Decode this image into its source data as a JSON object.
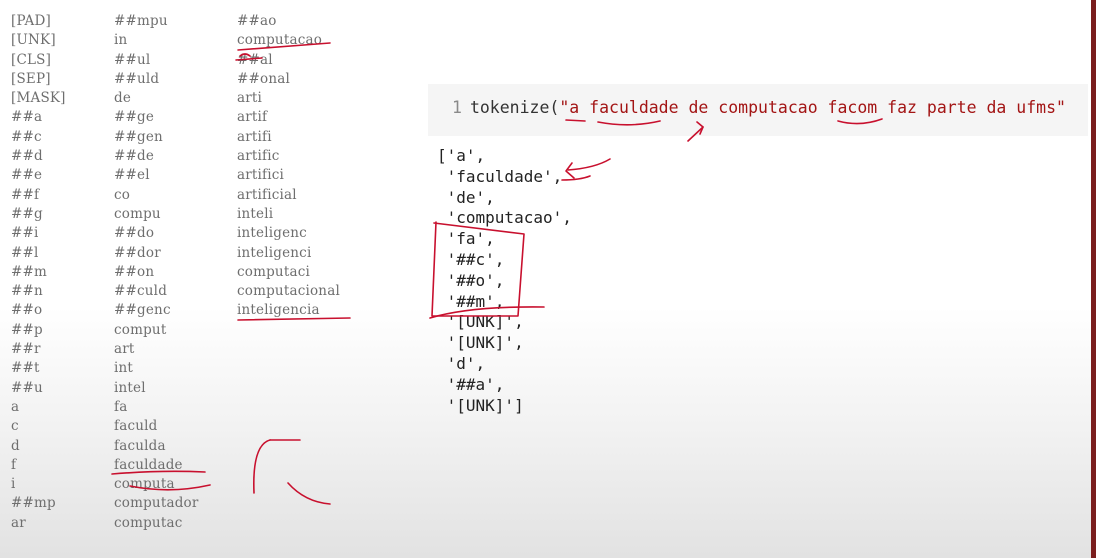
{
  "vocab": {
    "col1": [
      "[PAD]",
      "[UNK]",
      "[CLS]",
      "[SEP]",
      "[MASK]",
      "##a",
      "##c",
      "##d",
      "##e",
      "##f",
      "##g",
      "##i",
      "##l",
      "##m",
      "##n",
      "##o",
      "##p",
      "##r",
      "##t",
      "##u",
      "a",
      "c",
      "d",
      "f",
      "i",
      "##mp",
      "ar"
    ],
    "col2": [
      "##mpu",
      "in",
      "##ul",
      "##uld",
      "de",
      "##ge",
      "##gen",
      "##de",
      "##el",
      "co",
      "compu",
      "##do",
      "##dor",
      "##on",
      "##culd",
      "##genc",
      "comput",
      "art",
      "int",
      "intel",
      "fa",
      "faculd",
      "faculda",
      "faculdade",
      "computa",
      "computador",
      "computac"
    ],
    "col3": [
      "##ao",
      "computacao",
      "##al",
      "##onal",
      "arti",
      "artif",
      "artifi",
      "artific",
      "artifici",
      "artificial",
      "inteli",
      "inteligenc",
      "inteligenci",
      "computaci",
      "computacional",
      "inteligencia"
    ]
  },
  "code": {
    "line_number": "1",
    "func": "tokenize(",
    "arg": "\"a faculdade de computacao facom faz parte da ufms\""
  },
  "output_lines": [
    "['a',",
    " 'faculdade',",
    " 'de',",
    " 'computacao',",
    " 'fa',",
    " '##c',",
    " '##o',",
    " '##m',",
    " '[UNK]',",
    " '[UNK]',",
    " 'd',",
    " '##a',",
    " '[UNK]']"
  ]
}
